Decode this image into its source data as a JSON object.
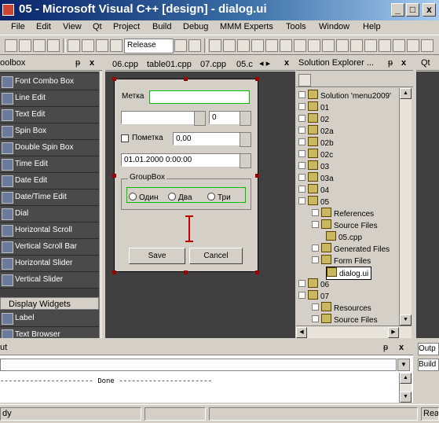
{
  "window": {
    "title": "05 - Microsoft Visual C++ [design] - dialog.ui",
    "min_label": "_",
    "max_label": "□",
    "close_label": "x"
  },
  "menu": [
    "File",
    "Edit",
    "View",
    "Qt",
    "Project",
    "Build",
    "Debug",
    "MMM Experts",
    "Tools",
    "Window",
    "Help"
  ],
  "toolbar": {
    "combo_text": "Release"
  },
  "toolbox": {
    "title": "oolbox",
    "pin_label": "ᵽ",
    "close_label": "x",
    "items": [
      "Font Combo Box",
      "Line Edit",
      "Text Edit",
      "Spin Box",
      "Double Spin Box",
      "Time Edit",
      "Date Edit",
      "Date/Time Edit",
      "Dial",
      "Horizontal Scroll",
      "Vertical Scroll Bar",
      "Horizontal Slider",
      "Vertical Slider"
    ],
    "section": "Display Widgets",
    "items2": [
      "Label",
      "Text Browser"
    ]
  },
  "editor": {
    "tabs": [
      "06.cpp",
      "table01.cpp",
      "07.cpp",
      "05.c"
    ],
    "tab_nav": "◂ ▸",
    "close_label": "x"
  },
  "form": {
    "label_text": "Метка",
    "combo_value": "",
    "spin_value": "0",
    "checkbox_label": "Пометка",
    "double_spin_value": "0,00",
    "datetime_value": "01.01.2000 0:00:00",
    "groupbox_title": "GroupBox",
    "radios": [
      "Один",
      "Два",
      "Три"
    ],
    "save_label": "Save",
    "cancel_label": "Cancel"
  },
  "solution": {
    "title": "Solution Explorer ...",
    "pin_label": "ᵽ",
    "close_label": "x",
    "tree": [
      {
        "label": "Solution 'menu2009'",
        "indent": 0
      },
      {
        "label": "01",
        "indent": 1
      },
      {
        "label": "02",
        "indent": 1
      },
      {
        "label": "02a",
        "indent": 1
      },
      {
        "label": "02b",
        "indent": 1
      },
      {
        "label": "02c",
        "indent": 1
      },
      {
        "label": "03",
        "indent": 1
      },
      {
        "label": "03a",
        "indent": 1
      },
      {
        "label": "04",
        "indent": 1
      },
      {
        "label": "05",
        "indent": 1
      },
      {
        "label": "References",
        "indent": 2
      },
      {
        "label": "Source Files",
        "indent": 2
      },
      {
        "label": "05.cpp",
        "indent": 3
      },
      {
        "label": "Generated Files",
        "indent": 2
      },
      {
        "label": "Form Files",
        "indent": 2
      },
      {
        "label": "dialog.ui",
        "indent": 3
      },
      {
        "label": "06",
        "indent": 1
      },
      {
        "label": "07",
        "indent": 1
      },
      {
        "label": "Resources",
        "indent": 2
      },
      {
        "label": "Source Files",
        "indent": 2
      }
    ]
  },
  "right_panel": {
    "title": "Qt",
    "close_label": "x"
  },
  "output": {
    "title": "ut",
    "pin_label": "ᵽ",
    "close_label": "x",
    "done_line": "---------------------- Done ----------------------"
  },
  "output_right": {
    "tab1": "Outp",
    "tab2": "Build"
  },
  "status": {
    "ready": "dy",
    "right": "Rea"
  },
  "colors": {
    "title_dark": "#0a246a",
    "title_light": "#a6caf0",
    "panel_bg": "#d4d0c8",
    "dark_area": "#404040",
    "selection_green": "#00c000"
  }
}
